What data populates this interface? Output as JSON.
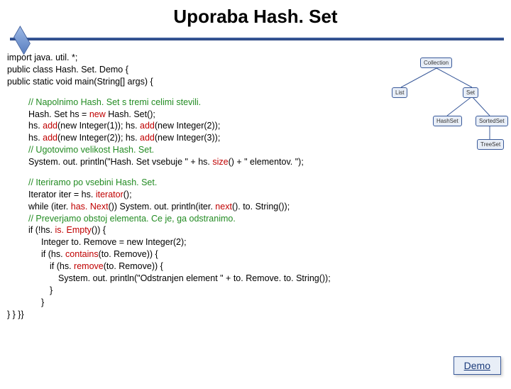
{
  "title": "Uporaba Hash. Set",
  "code": {
    "b1l1": "import java. util. *;",
    "b1l2": "public class Hash. Set. Demo  {",
    "b1l3": "  public static void main(String[] args) {",
    "b2c1": "// Napolnimo Hash. Set s tremi celimi stevili.",
    "b2l2a": "Hash. Set hs = ",
    "b2l2b": "new",
    "b2l2c": " Hash. Set();",
    "b2l3a": "hs. ",
    "b2l3b": "add",
    "b2l3c": "(new Integer(1));     hs. ",
    "b2l3d": "add",
    "b2l3e": "(new Integer(2));",
    "b2l4a": "hs. ",
    "b2l4b": "add",
    "b2l4c": "(new Integer(2));     hs. ",
    "b2l4d": "add",
    "b2l4e": "(new Integer(3));",
    "b2c2": "// Ugotovimo velikost Hash. Set.",
    "b2l6a": "System. out. println(\"Hash. Set vsebuje \" +  hs. ",
    "b2l6b": "size",
    "b2l6c": "() + \" elementov. \");",
    "b3c1": "// Iteriramo po vsebini Hash. Set.",
    "b3l2a": "Iterator iter = hs. ",
    "b3l2b": "iterator",
    "b3l2c": "();",
    "b3l3a": "while (iter. ",
    "b3l3b": "has. Next",
    "b3l3c": "())   System. out. println(iter. ",
    "b3l3d": "next",
    "b3l3e": "(). to. String());",
    "b3c2": "// Preverjamo obstoj elementa. Ce je, ga odstranimo.",
    "b3l5a": "if (!hs. ",
    "b3l5b": "is. Empty",
    "b3l5c": "()) {",
    "b3l6": "Integer to. Remove = new Integer(2);",
    "b3l7a": "if (hs. ",
    "b3l7b": "contains",
    "b3l7c": "(to. Remove)) {",
    "b3l8a": "if (hs. ",
    "b3l8b": "remove",
    "b3l8c": "(to. Remove)) {",
    "b3l9": "System. out. println(\"Odstranjen element \" + to. Remove. to. String());",
    "b3l10": "}",
    "b3l11": "}",
    "b3end": "} } }}"
  },
  "diagram": {
    "n1": "Collection",
    "n2": "List",
    "n3": "Set",
    "n4": "HashSet",
    "n5": "SortedSet",
    "n6": "TreeSet"
  },
  "demo_label": "Demo"
}
